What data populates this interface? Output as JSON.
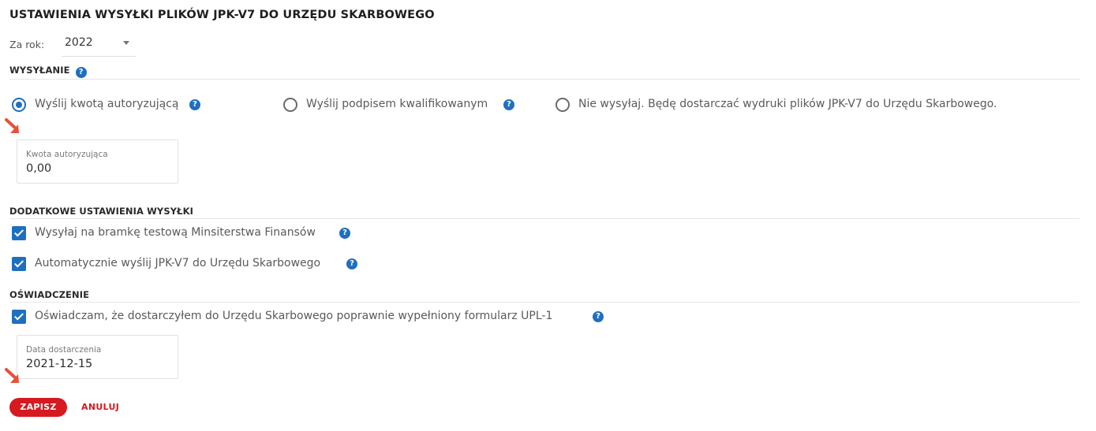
{
  "title": "USTAWIENIA WYSYŁKI PLIKÓW JPK-V7 DO URZĘDU SKARBOWEGO",
  "year": {
    "label": "Za rok:",
    "value": "2022"
  },
  "sending": {
    "title": "WYSYŁANIE",
    "options": [
      {
        "label": "Wyślij kwotą autoryzującą",
        "checked": true,
        "has_help": true
      },
      {
        "label": "Wyślij podpisem kwalifikowanym",
        "checked": false,
        "has_help": true
      },
      {
        "label": "Nie wysyłaj. Będę dostarczać wydruki plików JPK-V7 do Urzędu Skarbowego.",
        "checked": false,
        "has_help": false
      }
    ],
    "amount_field": {
      "label": "Kwota autoryzująca",
      "value": "0,00"
    }
  },
  "additional": {
    "title": "DODATKOWE USTAWIENIA WYSYŁKI",
    "checkboxes": [
      {
        "label": "Wysyłaj na bramkę testową Minsiterstwa Finansów",
        "checked": true
      },
      {
        "label": "Automatycznie wyślij JPK-V7 do Urzędu Skarbowego",
        "checked": true
      }
    ]
  },
  "statement": {
    "title": "OŚWIADCZENIE",
    "checkbox": {
      "label": "Oświadczam, że dostarczyłem do Urzędu Skarbowego poprawnie wypełniony formularz UPL-1",
      "checked": true
    },
    "date_field": {
      "label": "Data dostarczenia",
      "value": "2021-12-15"
    }
  },
  "buttons": {
    "save": "ZAPISZ",
    "cancel": "ANULUJ"
  },
  "icons": {
    "help": "?"
  },
  "colors": {
    "accent_blue": "#1f6fbf",
    "primary_red": "#d71920",
    "arrow_red": "#e8503a"
  }
}
